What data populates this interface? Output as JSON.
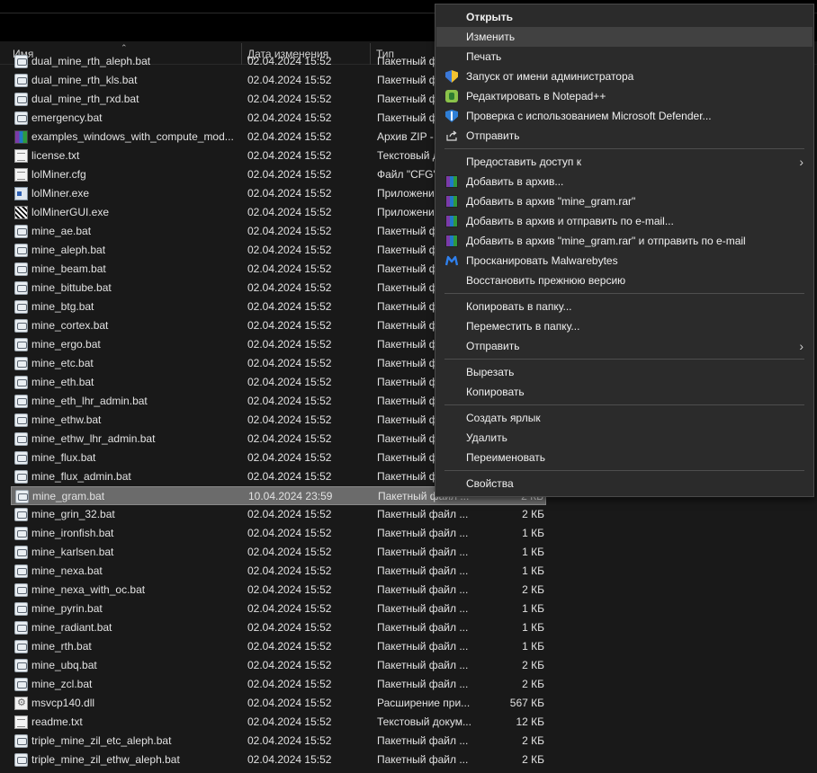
{
  "columns": {
    "name": "Имя",
    "date": "Дата изменения",
    "type": "Тип"
  },
  "files": [
    {
      "name": "dual_mine_rth_aleph.bat",
      "date": "02.04.2024 15:52",
      "type": "Пакетный файл ...",
      "size": "",
      "icon": "bat-file-icon"
    },
    {
      "name": "dual_mine_rth_kls.bat",
      "date": "02.04.2024 15:52",
      "type": "Пакетный файл ...",
      "size": "",
      "icon": "bat-file-icon"
    },
    {
      "name": "dual_mine_rth_rxd.bat",
      "date": "02.04.2024 15:52",
      "type": "Пакетный файл ...",
      "size": "",
      "icon": "bat-file-icon"
    },
    {
      "name": "emergency.bat",
      "date": "02.04.2024 15:52",
      "type": "Пакетный файл ...",
      "size": "",
      "icon": "bat-file-icon"
    },
    {
      "name": "examples_windows_with_compute_mod...",
      "date": "02.04.2024 15:52",
      "type": "Архив ZIP - WinRAR",
      "size": "",
      "icon": "zip-archive-icon"
    },
    {
      "name": "license.txt",
      "date": "02.04.2024 15:52",
      "type": "Текстовый документ",
      "size": "",
      "icon": "text-file-icon"
    },
    {
      "name": "lolMiner.cfg",
      "date": "02.04.2024 15:52",
      "type": "Файл \"CFG\"",
      "size": "",
      "icon": "text-file-icon"
    },
    {
      "name": "lolMiner.exe",
      "date": "02.04.2024 15:52",
      "type": "Приложение",
      "size": "",
      "icon": "exe-file-icon"
    },
    {
      "name": "lolMinerGUI.exe",
      "date": "02.04.2024 15:52",
      "type": "Приложение",
      "size": "",
      "icon": "gui-exe-icon"
    },
    {
      "name": "mine_ae.bat",
      "date": "02.04.2024 15:52",
      "type": "Пакетный файл ...",
      "size": "",
      "icon": "bat-file-icon"
    },
    {
      "name": "mine_aleph.bat",
      "date": "02.04.2024 15:52",
      "type": "Пакетный файл ...",
      "size": "",
      "icon": "bat-file-icon"
    },
    {
      "name": "mine_beam.bat",
      "date": "02.04.2024 15:52",
      "type": "Пакетный файл ...",
      "size": "",
      "icon": "bat-file-icon"
    },
    {
      "name": "mine_bittube.bat",
      "date": "02.04.2024 15:52",
      "type": "Пакетный файл ...",
      "size": "",
      "icon": "bat-file-icon"
    },
    {
      "name": "mine_btg.bat",
      "date": "02.04.2024 15:52",
      "type": "Пакетный файл ...",
      "size": "",
      "icon": "bat-file-icon"
    },
    {
      "name": "mine_cortex.bat",
      "date": "02.04.2024 15:52",
      "type": "Пакетный файл ...",
      "size": "",
      "icon": "bat-file-icon"
    },
    {
      "name": "mine_ergo.bat",
      "date": "02.04.2024 15:52",
      "type": "Пакетный файл ...",
      "size": "",
      "icon": "bat-file-icon"
    },
    {
      "name": "mine_etc.bat",
      "date": "02.04.2024 15:52",
      "type": "Пакетный файл ...",
      "size": "",
      "icon": "bat-file-icon"
    },
    {
      "name": "mine_eth.bat",
      "date": "02.04.2024 15:52",
      "type": "Пакетный файл ...",
      "size": "",
      "icon": "bat-file-icon"
    },
    {
      "name": "mine_eth_lhr_admin.bat",
      "date": "02.04.2024 15:52",
      "type": "Пакетный файл ...",
      "size": "",
      "icon": "bat-file-icon"
    },
    {
      "name": "mine_ethw.bat",
      "date": "02.04.2024 15:52",
      "type": "Пакетный файл ...",
      "size": "",
      "icon": "bat-file-icon"
    },
    {
      "name": "mine_ethw_lhr_admin.bat",
      "date": "02.04.2024 15:52",
      "type": "Пакетный файл ...",
      "size": "",
      "icon": "bat-file-icon"
    },
    {
      "name": "mine_flux.bat",
      "date": "02.04.2024 15:52",
      "type": "Пакетный файл ...",
      "size": "",
      "icon": "bat-file-icon"
    },
    {
      "name": "mine_flux_admin.bat",
      "date": "02.04.2024 15:52",
      "type": "Пакетный файл ...",
      "size": "",
      "icon": "bat-file-icon"
    },
    {
      "name": "mine_gram.bat",
      "date": "10.04.2024 23:59",
      "type": "Пакетный файл ...",
      "size": "2 КБ",
      "icon": "bat-file-icon",
      "selected": true
    },
    {
      "name": "mine_grin_32.bat",
      "date": "02.04.2024 15:52",
      "type": "Пакетный файл ...",
      "size": "2 КБ",
      "icon": "bat-file-icon"
    },
    {
      "name": "mine_ironfish.bat",
      "date": "02.04.2024 15:52",
      "type": "Пакетный файл ...",
      "size": "1 КБ",
      "icon": "bat-file-icon"
    },
    {
      "name": "mine_karlsen.bat",
      "date": "02.04.2024 15:52",
      "type": "Пакетный файл ...",
      "size": "1 КБ",
      "icon": "bat-file-icon"
    },
    {
      "name": "mine_nexa.bat",
      "date": "02.04.2024 15:52",
      "type": "Пакетный файл ...",
      "size": "1 КБ",
      "icon": "bat-file-icon"
    },
    {
      "name": "mine_nexa_with_oc.bat",
      "date": "02.04.2024 15:52",
      "type": "Пакетный файл ...",
      "size": "2 КБ",
      "icon": "bat-file-icon"
    },
    {
      "name": "mine_pyrin.bat",
      "date": "02.04.2024 15:52",
      "type": "Пакетный файл ...",
      "size": "1 КБ",
      "icon": "bat-file-icon"
    },
    {
      "name": "mine_radiant.bat",
      "date": "02.04.2024 15:52",
      "type": "Пакетный файл ...",
      "size": "1 КБ",
      "icon": "bat-file-icon"
    },
    {
      "name": "mine_rth.bat",
      "date": "02.04.2024 15:52",
      "type": "Пакетный файл ...",
      "size": "1 КБ",
      "icon": "bat-file-icon"
    },
    {
      "name": "mine_ubq.bat",
      "date": "02.04.2024 15:52",
      "type": "Пакетный файл ...",
      "size": "2 КБ",
      "icon": "bat-file-icon"
    },
    {
      "name": "mine_zcl.bat",
      "date": "02.04.2024 15:52",
      "type": "Пакетный файл ...",
      "size": "2 КБ",
      "icon": "bat-file-icon"
    },
    {
      "name": "msvcp140.dll",
      "date": "02.04.2024 15:52",
      "type": "Расширение при...",
      "size": "567 КБ",
      "icon": "dll-file-icon"
    },
    {
      "name": "readme.txt",
      "date": "02.04.2024 15:52",
      "type": "Текстовый докум...",
      "size": "12 КБ",
      "icon": "text-file-icon"
    },
    {
      "name": "triple_mine_zil_etc_aleph.bat",
      "date": "02.04.2024 15:52",
      "type": "Пакетный файл ...",
      "size": "2 КБ",
      "icon": "bat-file-icon"
    },
    {
      "name": "triple_mine_zil_ethw_aleph.bat",
      "date": "02.04.2024 15:52",
      "type": "Пакетный файл ...",
      "size": "2 КБ",
      "icon": "bat-file-icon"
    }
  ],
  "context_menu": {
    "items": [
      {
        "label": "Открыть",
        "bold": true,
        "icon": ""
      },
      {
        "label": "Изменить",
        "hover": true,
        "icon": ""
      },
      {
        "label": "Печать",
        "icon": ""
      },
      {
        "label": "Запуск от имени администратора",
        "icon": "uac-shield-icon"
      },
      {
        "label": "Редактировать в Notepad++",
        "icon": "notepad-plus-plus-icon"
      },
      {
        "label": "Проверка с использованием Microsoft Defender...",
        "icon": "defender-shield-icon"
      },
      {
        "label": "Отправить",
        "icon": "share-icon"
      },
      {
        "separator": true
      },
      {
        "label": "Предоставить доступ к",
        "submenu": true,
        "icon": ""
      },
      {
        "label": "Добавить в архив...",
        "icon": "winrar-icon"
      },
      {
        "label": "Добавить в архив \"mine_gram.rar\"",
        "icon": "winrar-icon"
      },
      {
        "label": "Добавить в архив и отправить по e-mail...",
        "icon": "winrar-icon"
      },
      {
        "label": "Добавить в архив \"mine_gram.rar\" и отправить по e-mail",
        "icon": "winrar-icon"
      },
      {
        "label": "Просканировать Malwarebytes",
        "icon": "malwarebytes-icon"
      },
      {
        "label": "Восстановить прежнюю версию",
        "icon": ""
      },
      {
        "separator": true
      },
      {
        "label": "Копировать в папку...",
        "icon": ""
      },
      {
        "label": "Переместить в папку...",
        "icon": ""
      },
      {
        "label": "Отправить",
        "submenu": true,
        "icon": ""
      },
      {
        "separator": true
      },
      {
        "label": "Вырезать",
        "icon": ""
      },
      {
        "label": "Копировать",
        "icon": ""
      },
      {
        "separator": true
      },
      {
        "label": "Создать ярлык",
        "icon": ""
      },
      {
        "label": "Удалить",
        "icon": ""
      },
      {
        "label": "Переименовать",
        "icon": ""
      },
      {
        "separator": true
      },
      {
        "label": "Свойства",
        "icon": ""
      }
    ]
  },
  "colors": {
    "background": "#191919",
    "menu": "#2b2b2b",
    "selected_row": "#6b6b6b",
    "menu_hover": "#414141"
  }
}
